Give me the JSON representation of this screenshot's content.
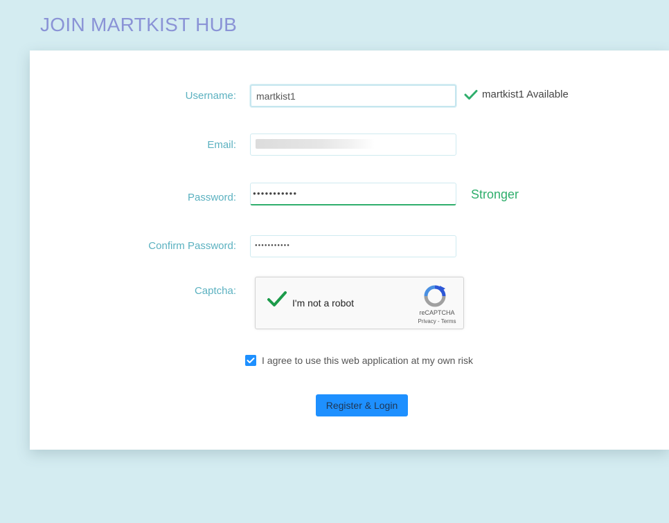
{
  "page": {
    "title": "JOIN MARTKIST HUB"
  },
  "form": {
    "username_label": "Username:",
    "username_value": "martkist1",
    "availability_text": "martkist1 Available",
    "email_label": "Email:",
    "password_label": "Password:",
    "password_mask": "●●●●●●●●●●●",
    "password_strength": "Stronger",
    "confirm_label": "Confirm Password:",
    "confirm_mask": "●●●●●●●●●●●",
    "captcha_label": "Captcha:",
    "agree_text": "I agree to use this web application at my own risk",
    "agree_checked": true,
    "submit_label": "Register & Login"
  },
  "captcha": {
    "text": "I'm not a robot",
    "brand": "reCAPTCHA",
    "links": "Privacy - Terms",
    "checked": true
  },
  "colors": {
    "background": "#d4ecf1",
    "title": "#8a93d6",
    "label": "#5bb1c0",
    "strength": "#2fae6c",
    "button": "#1e90ff",
    "check_green": "#2fae6c"
  },
  "icons": {
    "available": "check-icon",
    "captcha_check": "check-icon",
    "captcha_logo": "recaptcha-logo-icon",
    "agree_checkbox": "checkmark-icon"
  }
}
